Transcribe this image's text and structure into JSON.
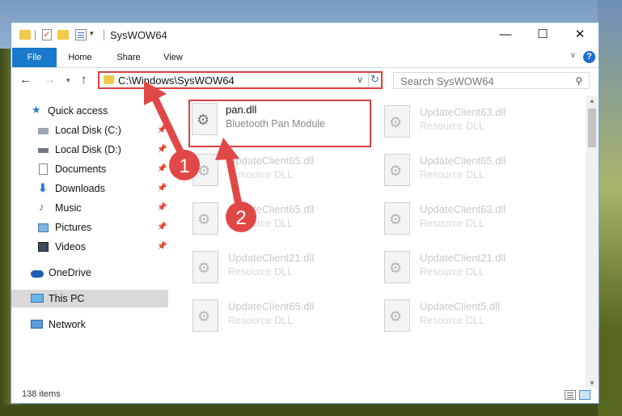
{
  "window": {
    "title": "SysWOW64",
    "minimize_glyph": "—",
    "maximize_glyph": "☐",
    "close_glyph": "✕"
  },
  "ribbon": {
    "tabs": [
      "File",
      "Home",
      "Share",
      "View"
    ],
    "expand_glyph": "∨",
    "help_glyph": "?"
  },
  "nav": {
    "address": "C:\\Windows\\SysWOW64",
    "search_placeholder": "Search SysWOW64"
  },
  "sidebar": {
    "items": [
      {
        "label": "Quick access",
        "icon": "star-icon",
        "pinned": false
      },
      {
        "label": "Local Disk (C:)",
        "icon": "drive-icon",
        "pinned": true
      },
      {
        "label": "Local Disk (D:)",
        "icon": "drive-icon",
        "pinned": true
      },
      {
        "label": "Documents",
        "icon": "documents-icon",
        "pinned": true
      },
      {
        "label": "Downloads",
        "icon": "download-icon",
        "pinned": true
      },
      {
        "label": "Music",
        "icon": "music-icon",
        "pinned": true
      },
      {
        "label": "Pictures",
        "icon": "pictures-icon",
        "pinned": true
      },
      {
        "label": "Videos",
        "icon": "videos-icon",
        "pinned": true
      },
      {
        "label": "OneDrive",
        "icon": "cloud-icon",
        "pinned": false
      },
      {
        "label": "This PC",
        "icon": "computer-icon",
        "pinned": false
      },
      {
        "label": "Network",
        "icon": "network-icon",
        "pinned": false
      }
    ]
  },
  "files": [
    {
      "name": "pan.dll",
      "desc": "Bluetooth Pan Module"
    },
    {
      "name": "UpdateClient63.dll",
      "desc": "Resource DLL"
    },
    {
      "name": "UpdateClient65.dll",
      "desc": "Resource DLL"
    },
    {
      "name": "UpdateClient65.dll",
      "desc": "Resource DLL"
    },
    {
      "name": "UpdateClient65.dll",
      "desc": "Resource DLL"
    },
    {
      "name": "UpdateClient63.dll",
      "desc": "Resource DLL"
    },
    {
      "name": "UpdateClient21.dll",
      "desc": "Resource DLL"
    },
    {
      "name": "UpdateClient21.dll",
      "desc": "Resource DLL"
    },
    {
      "name": "UpdateClient65.dll",
      "desc": "Resource DLL"
    },
    {
      "name": "UpdateClient5.dll",
      "desc": "Resource DLL"
    }
  ],
  "status": {
    "item_count": "138 items"
  },
  "annotations": {
    "step1": "1",
    "step2": "2",
    "color": "#e04848"
  }
}
